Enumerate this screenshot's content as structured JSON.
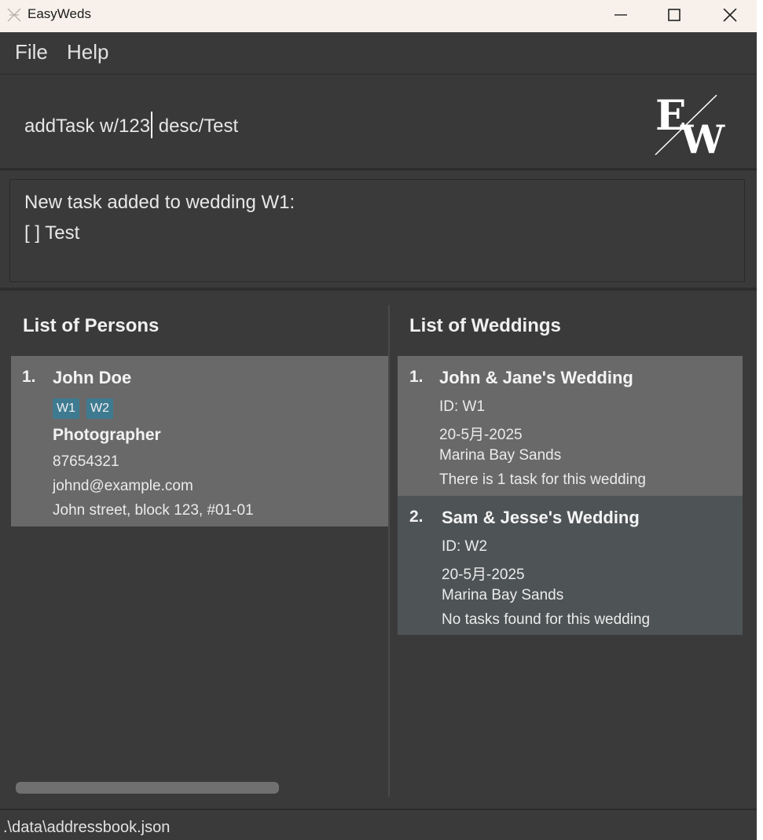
{
  "window": {
    "title": "EasyWeds"
  },
  "menu": {
    "file": "File",
    "help": "Help"
  },
  "command": {
    "before_caret": "addTask w/123",
    "after_caret": " desc/Test"
  },
  "logo": {
    "text_e": "E",
    "text_w": "W"
  },
  "result": {
    "line1": "New task added to wedding W1:",
    "line2": "[ ] Test"
  },
  "persons": {
    "title": "List of Persons",
    "items": [
      {
        "index": "1.",
        "name": "John Doe",
        "tags": [
          "W1",
          "W2"
        ],
        "job": "Photographer",
        "phone": "87654321",
        "email": "johnd@example.com",
        "address": "John street, block 123, #01-01"
      }
    ]
  },
  "weddings": {
    "title": "List of Weddings",
    "items": [
      {
        "index": "1.",
        "name": "John & Jane's Wedding",
        "id": "ID: W1",
        "date": "20-5月-2025",
        "venue": "Marina Bay Sands",
        "tasks": "There is 1 task for this wedding"
      },
      {
        "index": "2.",
        "name": "Sam & Jesse's Wedding",
        "id": "ID: W2",
        "date": "20-5月-2025",
        "venue": "Marina Bay Sands",
        "tasks": "No tasks found for this wedding"
      }
    ]
  },
  "status": {
    "file_path": ".\\data\\addressbook.json"
  },
  "colors": {
    "background": "#3a3a3a",
    "card": "#696969",
    "card_alt": "#4e5355",
    "tag": "#3e7b91"
  }
}
